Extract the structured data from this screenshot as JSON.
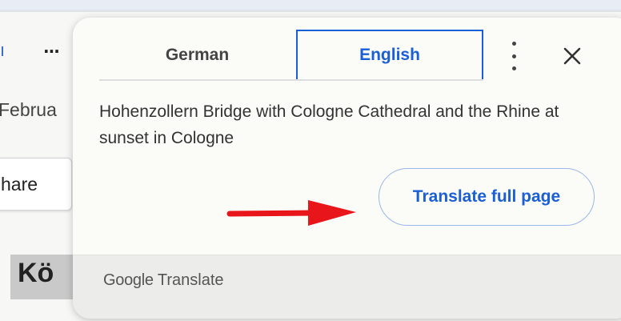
{
  "background": {
    "date_fragment": "Februa",
    "share_fragment": "hare",
    "heading_fragment": "Kö"
  },
  "popup": {
    "tabs": [
      {
        "label": "German",
        "selected": false
      },
      {
        "label": "English",
        "selected": true
      }
    ],
    "more_icon": "vertical-ellipsis-icon",
    "close_icon": "close-icon",
    "translated_text": "Hohenzollern Bridge with Cologne Cathedral and the Rhine at sunset in Cologne",
    "translate_full_page_label": "Translate full page",
    "footer": {
      "brand": "Google",
      "product": "Translate"
    },
    "accent_color": "#1a5fd6",
    "annotation_arrow_color": "#e8151b"
  }
}
